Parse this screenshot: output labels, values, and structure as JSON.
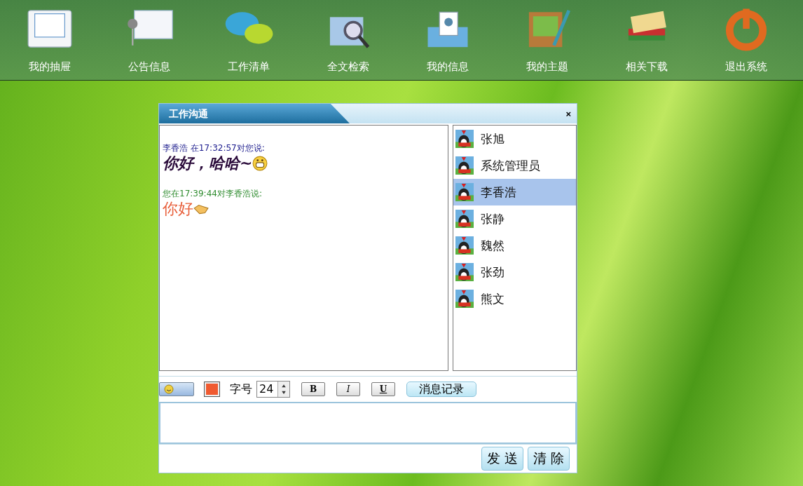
{
  "nav": [
    {
      "label": "我的抽屉"
    },
    {
      "label": "公告信息"
    },
    {
      "label": "工作清单"
    },
    {
      "label": "全文检索"
    },
    {
      "label": "我的信息"
    },
    {
      "label": "我的主题"
    },
    {
      "label": "相关下载"
    },
    {
      "label": "退出系统"
    }
  ],
  "dialog": {
    "title": "工作沟通",
    "close": "×",
    "messages": [
      {
        "kind": "received",
        "header": "李香浩 在17:32:57对您说:",
        "text": "你好，哈哈~",
        "color": "#2a0a3a",
        "bold": true,
        "italic": true,
        "emoji": {
          "kind": "grin"
        }
      },
      {
        "kind": "sent",
        "header": "您在17:39:44对李香浩说:",
        "text": "你好",
        "color": "#e8603c",
        "bold": false,
        "italic": false,
        "emoji": {
          "kind": "handshake"
        }
      }
    ],
    "users": [
      {
        "name": "张旭",
        "selected": false
      },
      {
        "name": "系统管理员",
        "selected": false
      },
      {
        "name": "李香浩",
        "selected": true
      },
      {
        "name": "张静",
        "selected": false
      },
      {
        "name": "魏然",
        "selected": false
      },
      {
        "name": "张劲",
        "selected": false
      },
      {
        "name": "熊文",
        "selected": false
      }
    ],
    "toolbar": {
      "color_picker": {
        "color": "#f05a30"
      },
      "size_label": "字号",
      "size": "24",
      "bold": "B",
      "italic": "I",
      "underline": "U",
      "history": "消息记录"
    },
    "buttons": [
      "发 送",
      "清 除"
    ]
  }
}
